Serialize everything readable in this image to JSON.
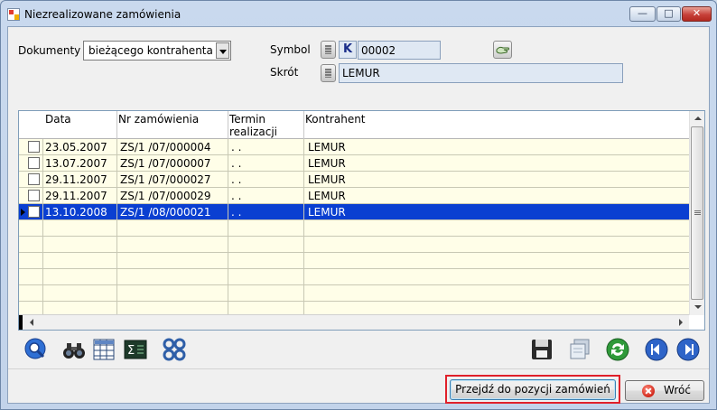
{
  "window": {
    "title": "Niezrealizowane zamówienia",
    "controls": {
      "minimize": "—",
      "maximize": "□",
      "close": "✕"
    }
  },
  "filters": {
    "dokumenty_label": "Dokumenty",
    "dokumenty_value": "bieżącego kontrahenta",
    "symbol_label": "Symbol",
    "symbol_prefix": "K",
    "symbol_value": "00002",
    "skrot_label": "Skrót",
    "skrot_value": "LEMUR"
  },
  "grid": {
    "columns": [
      "Data",
      "Nr zamówienia",
      "Termin realizacji",
      "Kontrahent"
    ],
    "rows": [
      {
        "data": "23.05.2007",
        "nr": "ZS/1  /07/000004",
        "termin": ". .",
        "kontrahent": "LEMUR",
        "selected": false
      },
      {
        "data": "13.07.2007",
        "nr": "ZS/1  /07/000007",
        "termin": ". .",
        "kontrahent": "LEMUR",
        "selected": false
      },
      {
        "data": "29.11.2007",
        "nr": "ZS/1  /07/000027",
        "termin": ". .",
        "kontrahent": "LEMUR",
        "selected": false
      },
      {
        "data": "29.11.2007",
        "nr": "ZS/1  /07/000029",
        "termin": ". .",
        "kontrahent": "LEMUR",
        "selected": false
      },
      {
        "data": "13.10.2008",
        "nr": "ZS/1  /08/000021",
        "termin": ". .",
        "kontrahent": "LEMUR",
        "selected": true
      }
    ]
  },
  "toolbar": {
    "left_icons": [
      "preview-icon",
      "binoculars-icon",
      "grid-columns-icon",
      "sum-icon",
      "filter-icon"
    ],
    "right_icons": [
      "save-icon",
      "copy-icon",
      "refresh-icon",
      "prev-icon",
      "next-icon"
    ]
  },
  "buttons": {
    "przejdz": "Przejdź do pozycji zamówień",
    "wroc": "Wróć"
  },
  "colors": {
    "selected_row": "#0a3fd1",
    "row_background": "#fffee8",
    "highlight_outline": "#e0202a"
  }
}
